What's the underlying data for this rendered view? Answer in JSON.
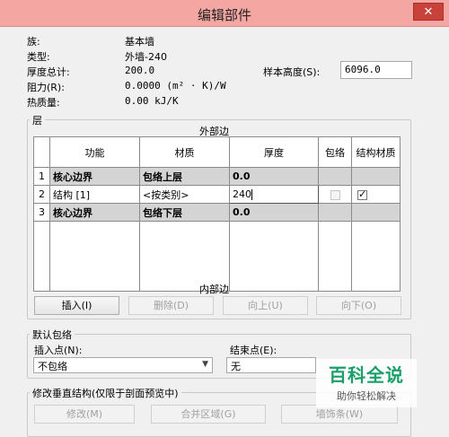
{
  "window": {
    "title": "编辑部件",
    "close_glyph": "✕"
  },
  "properties": {
    "family_label": "族:",
    "family_value": "基本墙",
    "type_label": "类型:",
    "type_value": "外墙-240",
    "thickness_label": "厚度总计:",
    "thickness_value": "200.0",
    "resistance_label": "阻力(R):",
    "resistance_value": "0.0000 (m² · K)/W",
    "thermal_label": "热质量:",
    "thermal_value": "0.00 kJ/K",
    "sample_height_label": "样本高度(S):",
    "sample_height_value": "6096.0"
  },
  "layers": {
    "group_title": "层",
    "exterior_label": "外部边",
    "interior_label": "内部边",
    "columns": [
      "功能",
      "材质",
      "厚度",
      "包络",
      "结构材质"
    ],
    "rows": [
      {
        "index": "1",
        "function": "核心边界",
        "material": "包络上层",
        "thickness": "0.0",
        "core": true
      },
      {
        "index": "2",
        "function": "结构 [1]",
        "material": "<按类别>",
        "thickness": "240",
        "core": false,
        "wraps": false,
        "structural": true
      },
      {
        "index": "3",
        "function": "核心边界",
        "material": "包络下层",
        "thickness": "0.0",
        "core": true
      }
    ],
    "buttons": {
      "insert": "插入(I)",
      "delete": "删除(D)",
      "up": "向上(U)",
      "down": "向下(O)"
    }
  },
  "default_wrapping": {
    "group_title": "默认包络",
    "insert_point_label": "插入点(N):",
    "insert_point_value": "不包络",
    "end_point_label": "结束点(E):",
    "end_point_value": "无"
  },
  "vertical_structure": {
    "group_title": "修改垂直结构(仅限于剖面预览中)",
    "buttons": {
      "modify": "修改(M)",
      "merge": "合并区域(G)",
      "sweep": "墙饰条(W)"
    }
  },
  "watermark": {
    "main": "百科全说",
    "sub": "助你轻松解决"
  }
}
